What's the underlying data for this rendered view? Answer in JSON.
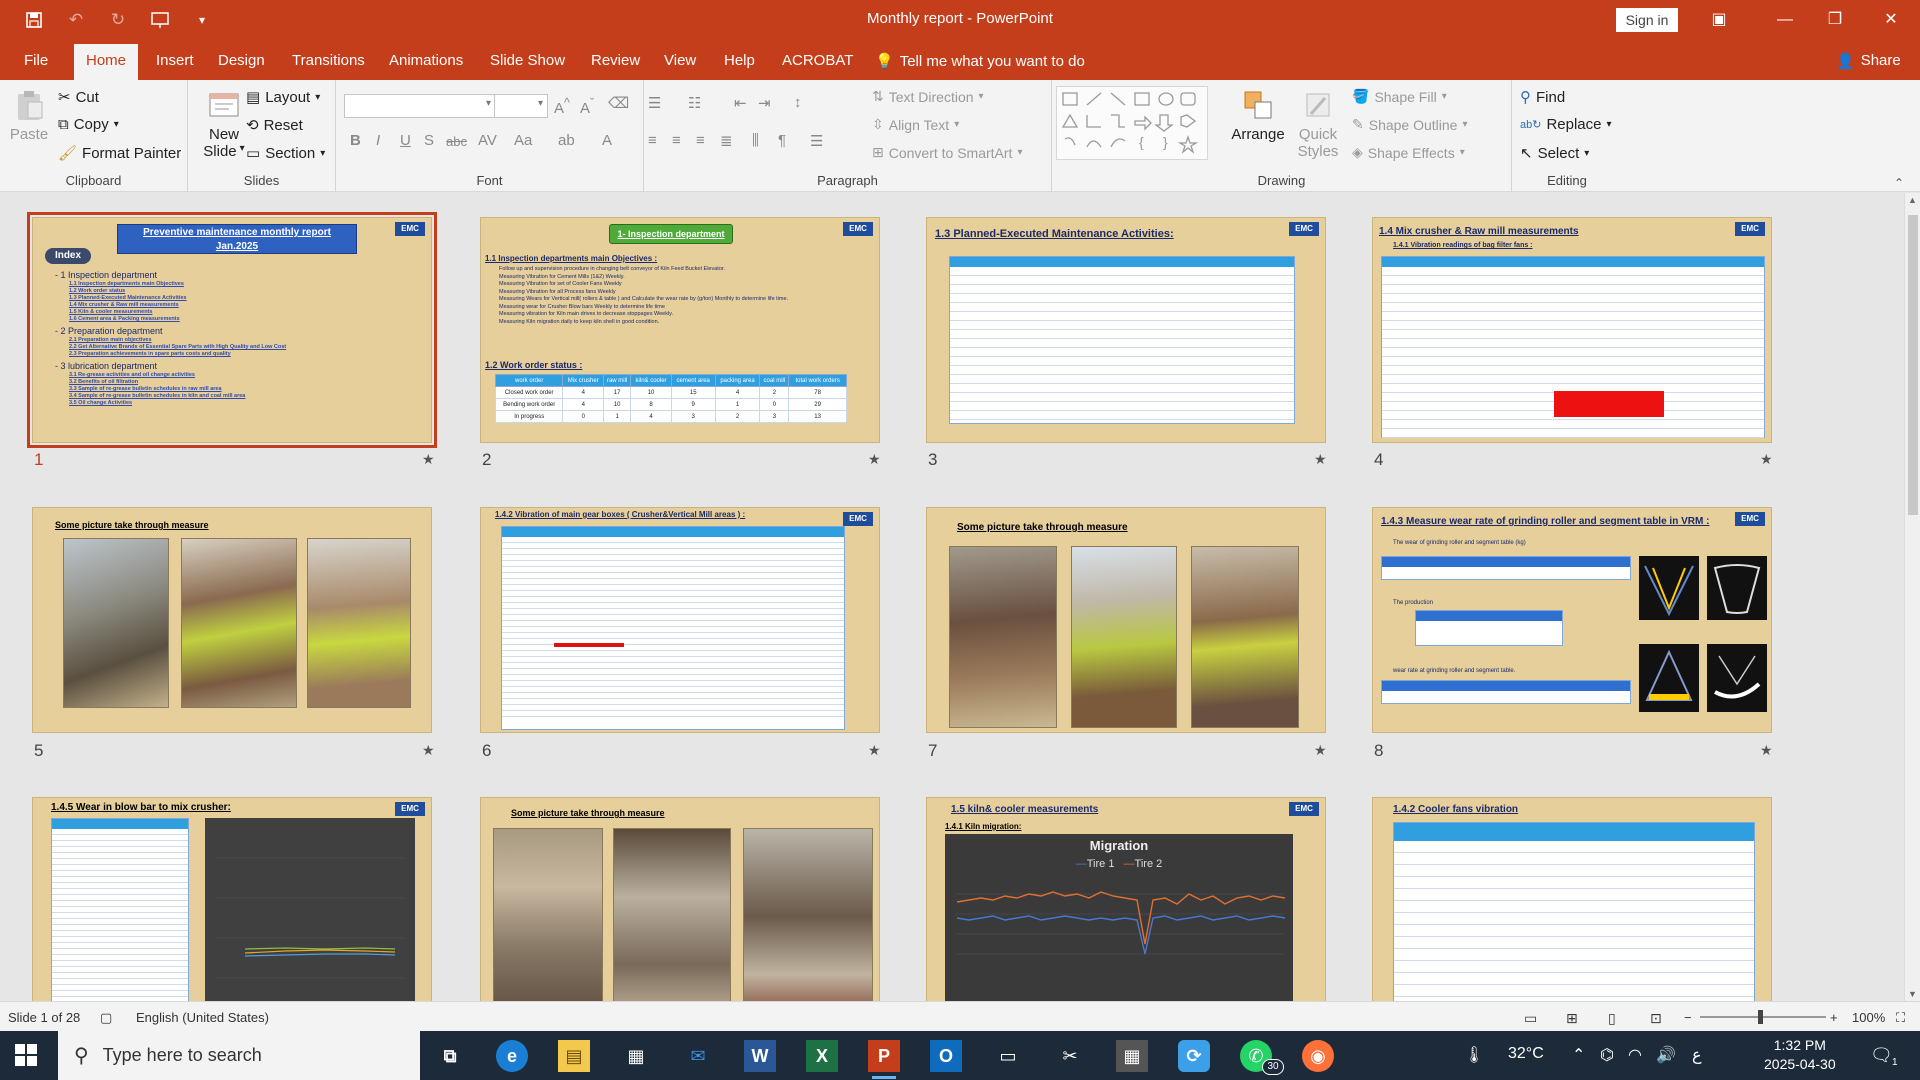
{
  "window": {
    "app_title": "Monthly report  -  PowerPoint",
    "sign_in": "Sign in"
  },
  "tabs": [
    "File",
    "Home",
    "Insert",
    "Design",
    "Transitions",
    "Animations",
    "Slide Show",
    "Review",
    "View",
    "Help",
    "ACROBAT"
  ],
  "active_tab": "Home",
  "tell_me": "Tell me what you want to do",
  "share": "Share",
  "ribbon": {
    "clipboard": {
      "label": "Clipboard",
      "paste": "Paste",
      "cut": "Cut",
      "copy": "Copy",
      "format_painter": "Format Painter"
    },
    "slides": {
      "label": "Slides",
      "new_slide_1": "New",
      "new_slide_2": "Slide",
      "layout": "Layout",
      "reset": "Reset",
      "section": "Section"
    },
    "font": {
      "label": "Font"
    },
    "paragraph": {
      "label": "Paragraph",
      "text_direction": "Text Direction",
      "align_text": "Align Text",
      "convert_smartart": "Convert to SmartArt"
    },
    "drawing": {
      "label": "Drawing",
      "arrange": "Arrange",
      "quick_styles_1": "Quick",
      "quick_styles_2": "Styles",
      "shape_fill": "Shape Fill",
      "shape_outline": "Shape Outline",
      "shape_effects": "Shape Effects"
    },
    "editing": {
      "label": "Editing",
      "find": "Find",
      "replace": "Replace",
      "select": "Select"
    }
  },
  "slides": [
    {
      "num": "1",
      "title": "Preventive maintenance monthly report",
      "subtitle": "Jan.2025",
      "index_label": "Index",
      "toc": [
        {
          "text": "- 1 Inspection department",
          "level": 1
        },
        {
          "text": "1.1 Inspection departments main Objectives",
          "level": 2
        },
        {
          "text": "1.2 Work order status",
          "level": 2
        },
        {
          "text": "1.3 Planned-Executed Maintenance Activities",
          "level": 2
        },
        {
          "text": "1.4 Mix crusher & Raw mill measurements",
          "level": 2
        },
        {
          "text": "1.5 Kiln & cooler  measurements",
          "level": 2
        },
        {
          "text": "1.6 Cement area & Packing measurements",
          "level": 2
        },
        {
          "text": "- 2 Preparation department",
          "level": 1
        },
        {
          "text": "2.1 Preparation main objectives",
          "level": 2
        },
        {
          "text": "2.2 Get Alternative Brands of Essential Spare Parts with High Quality and Low Cost",
          "level": 2
        },
        {
          "text": "2.3 Preparation achievements in spare parts costs and quality",
          "level": 2
        },
        {
          "text": "- 3 lubrication department",
          "level": 1
        },
        {
          "text": "3.1 Re-grease activities and oil change activities",
          "level": 2
        },
        {
          "text": "3.2 Benefits of oil filtration",
          "level": 2
        },
        {
          "text": "3.3 Sample of re-grease bulletin schedules in raw mill area",
          "level": 2
        },
        {
          "text": "3.4 Sample of re-grease bulletin schedules in kiln and coal mill area",
          "level": 2
        },
        {
          "text": "3.5 Oil change Activities",
          "level": 2
        }
      ]
    },
    {
      "num": "2",
      "title": "1- Inspection department",
      "section": "1.1 Inspection departments main Objectives :",
      "bullets": [
        "Follow up and supervision procedure in changing belt conveyor of Kiln Feed Bucket Elevator.",
        "Measuring Vibration for Cement Mills (1&2) Weekly.",
        "Measuring Vibration for set of Cooler Fans Weekly",
        "Measuring Vibration for all Process fans Weekly",
        "Measuring Wears for Vertical mill( rollers & table ) and Calculate the wear rate by (g/ton) Monthly  to determine life time.",
        "Measuring wear for Crusher Blow bars Weekly to determine life time",
        "Measuring vibration for Kiln main drives to decrease stoppages  Weekly.",
        "Measuring  Kiln migration daily to keep kiln shell in good condition."
      ],
      "section2": "1.2 Work order status :",
      "wo_headers": [
        "work order",
        "Mix crusher",
        "raw mill",
        "kiln& cooler",
        "cement area",
        "packing area",
        "coal mill",
        "total work orders"
      ],
      "wo_rows": [
        [
          "Closed work order",
          "4",
          "17",
          "10",
          "15",
          "4",
          "2",
          "78"
        ],
        [
          "Bending work order",
          "4",
          "10",
          "8",
          "9",
          "1",
          "0",
          "29"
        ],
        [
          "In progress",
          "0",
          "1",
          "4",
          "3",
          "2",
          "3",
          "13"
        ]
      ]
    },
    {
      "num": "3",
      "title": "1.3 Planned-Executed Maintenance Activities:"
    },
    {
      "num": "4",
      "title": "1.4 Mix crusher & Raw mill measurements",
      "sub": "1.4.1 Vibration readings of bag filter fans :"
    },
    {
      "num": "5",
      "title": "Some picture take through measure"
    },
    {
      "num": "6",
      "title": "1.4.2 Vibration of main gear boxes ( Crusher&Vertical Mill areas ) :"
    },
    {
      "num": "7",
      "title": "Some picture take through measure"
    },
    {
      "num": "8",
      "title": "1.4.3 Measure wear rate of grinding roller and segment table in VRM :",
      "b1": "The wear of grinding roller and segment table (kg)",
      "b2": "The production",
      "b3": "wear rate at grinding roller and segment table."
    },
    {
      "num": "9",
      "title": "1.4.5 Wear in blow bar to mix crusher:"
    },
    {
      "num": "10",
      "title": "Some picture take through measure"
    },
    {
      "num": "11",
      "title": "1.5  kiln& cooler measurements",
      "sub": "1.4.1 Kiln migration:",
      "chart_title": "Migration",
      "legend": [
        "Tire 1",
        "Tire 2"
      ]
    },
    {
      "num": "12",
      "title": "1.4.2 Cooler fans vibration"
    }
  ],
  "status": {
    "slide_of": "Slide 1 of 28",
    "language": "English (United States)",
    "zoom": "100%"
  },
  "taskbar": {
    "search": "Type here to search",
    "temperature": "32°C",
    "time": "1:32 PM",
    "date": "2025-04-30",
    "whatsapp_badge": "30",
    "notif_count": "1"
  },
  "colors": {
    "accent": "#c43e1c",
    "slide_bg": "#e6cf9a",
    "table_head": "#2f9fe0"
  }
}
